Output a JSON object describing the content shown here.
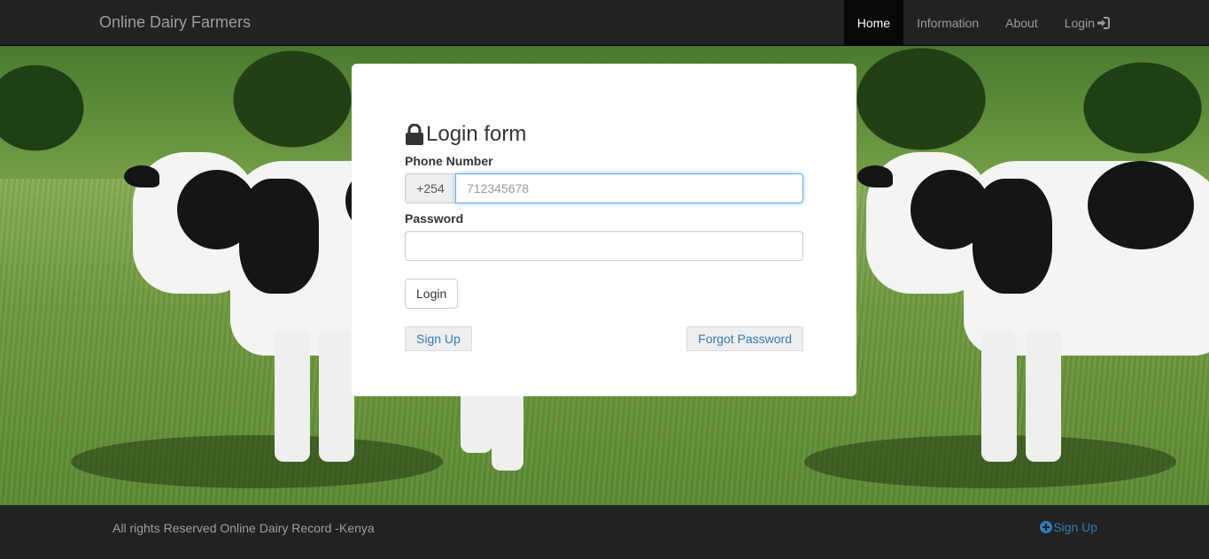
{
  "navbar": {
    "brand": "Online Dairy Farmers",
    "items": [
      {
        "label": "Home",
        "active": true
      },
      {
        "label": "Information",
        "active": false
      },
      {
        "label": "About",
        "active": false
      },
      {
        "label": "Login",
        "active": false,
        "icon": "login-icon"
      }
    ]
  },
  "login_form": {
    "title": "Login form",
    "title_icon": "lock-icon",
    "phone_label": "Phone Number",
    "phone_prefix": "+254",
    "phone_placeholder": "712345678",
    "phone_value": "",
    "password_label": "Password",
    "password_value": "",
    "login_button": "Login",
    "signup_link": "Sign Up",
    "forgot_link": "Forgot Password"
  },
  "footer": {
    "text": "All rights Reserved Online Dairy Record -Kenya",
    "signup_link": "Sign Up",
    "signup_icon": "plus-circle-icon"
  },
  "colors": {
    "navbar_bg": "#222222",
    "link": "#337ab7",
    "active_nav_bg": "#080808"
  }
}
